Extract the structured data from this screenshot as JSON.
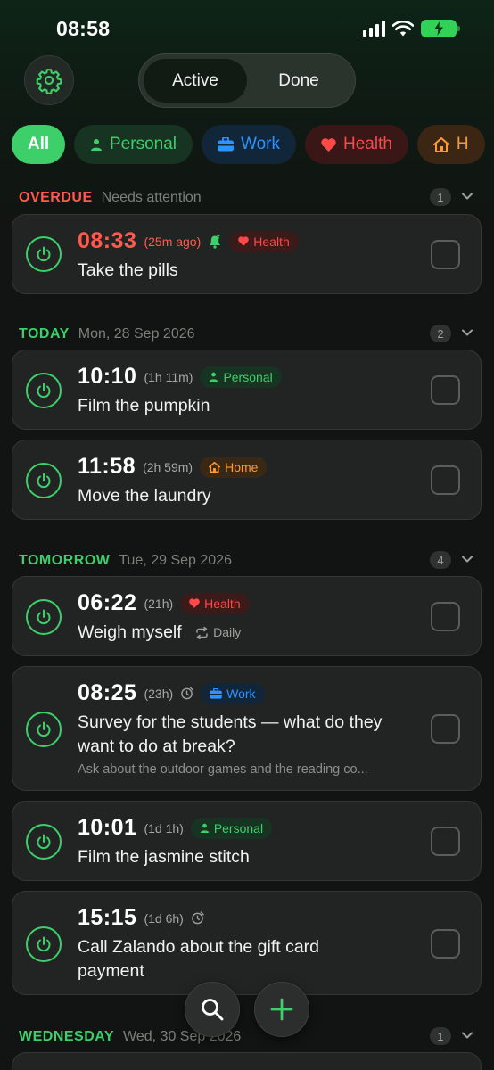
{
  "status_bar": {
    "time": "08:58"
  },
  "segments": [
    {
      "label": "Active",
      "selected": true
    },
    {
      "label": "Done",
      "selected": false
    }
  ],
  "filters": {
    "all": "All",
    "personal": "Personal",
    "work": "Work",
    "health": "Health",
    "home": "H"
  },
  "sections": {
    "overdue": {
      "title": "OVERDUE",
      "subtitle": "Needs attention",
      "count": "1",
      "color": "#ff5a4d"
    },
    "today": {
      "title": "TODAY",
      "subtitle": "Mon, 28 Sep 2026",
      "count": "2",
      "color": "#3ccf6a"
    },
    "tomorrow": {
      "title": "TOMORROW",
      "subtitle": "Tue, 29 Sep 2026",
      "count": "4",
      "color": "#3ccf6a"
    },
    "wednesday": {
      "title": "WEDNESDAY",
      "subtitle": "Wed, 30 Sep 2026",
      "count": "1",
      "color": "#3ccf6a"
    }
  },
  "tasks": {
    "t1": {
      "time": "08:33",
      "relative": "(25m ago)",
      "tag": "Health",
      "title": "Take the pills"
    },
    "t2": {
      "time": "10:10",
      "relative": "(1h 11m)",
      "tag": "Personal",
      "title": "Film the pumpkin"
    },
    "t3": {
      "time": "11:58",
      "relative": "(2h 59m)",
      "tag": "Home",
      "title": "Move the laundry"
    },
    "t4": {
      "time": "06:22",
      "relative": "(21h)",
      "tag": "Health",
      "title": "Weigh myself",
      "repeat": "Daily"
    },
    "t5": {
      "time": "08:25",
      "relative": "(23h)",
      "tag": "Work",
      "title": "Survey for the students — what do they want to do at break?",
      "note": "Ask about the outdoor games and the reading co..."
    },
    "t6": {
      "time": "10:01",
      "relative": "(1d 1h)",
      "tag": "Personal",
      "title": "Film the jasmine stitch"
    },
    "t7": {
      "time": "15:15",
      "relative": "(1d 6h)",
      "title": "Call Zalando about the gift card payment"
    }
  },
  "colors": {
    "accent": "#3ccf6a",
    "overdue": "#ff5a4d",
    "work": "#2e93ff",
    "health": "#ff4848",
    "home": "#ff9a2e"
  }
}
